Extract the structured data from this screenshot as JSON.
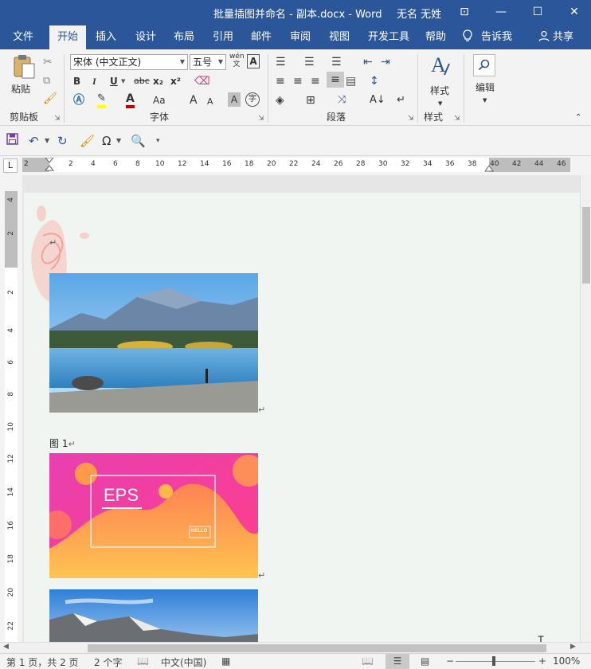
{
  "titlebar": {
    "doc_title": "批量插图并命名 - 副本.docx  -  Word",
    "user": "无名 无姓",
    "minimize": "—",
    "restore": "☐",
    "close": "✕",
    "ribbon_display": "⊡"
  },
  "menu": {
    "tabs": [
      "文件",
      "开始",
      "插入",
      "设计",
      "布局",
      "引用",
      "邮件",
      "审阅",
      "视图",
      "开发工具",
      "帮助"
    ],
    "active": "开始",
    "tell_me": "告诉我",
    "share": "共享"
  },
  "ribbon": {
    "clipboard": {
      "paste": "粘贴",
      "label": "剪贴板"
    },
    "font": {
      "name": "宋体 (中文正文)",
      "size": "五号",
      "label": "字体",
      "bold": "B",
      "italic": "I",
      "underline": "U",
      "strike": "abc",
      "sub": "x₂",
      "sup": "x²",
      "grow": "A",
      "shrink": "A",
      "case": "Aa",
      "wen": "wén",
      "char_border": "A",
      "char_shade": "A",
      "enclose": "字"
    },
    "paragraph": {
      "label": "段落"
    },
    "styles": {
      "button": "样式",
      "label": "样式"
    },
    "editing": {
      "button": "编辑"
    }
  },
  "ruler": {
    "tab_selector": "L",
    "h_ticks": [
      "2",
      "2",
      "4",
      "6",
      "8",
      "10",
      "12",
      "14",
      "16",
      "18",
      "20",
      "22",
      "24",
      "26",
      "28",
      "30",
      "32",
      "34",
      "36",
      "38",
      "40",
      "42",
      "44",
      "46"
    ],
    "v_ticks": [
      "4",
      "2",
      "2",
      "4",
      "6",
      "8",
      "10",
      "12",
      "14",
      "16",
      "18",
      "20",
      "22"
    ]
  },
  "document": {
    "caption": "图 1",
    "eps_title": "EPS",
    "hello_badge": "HELLO"
  },
  "statusbar": {
    "page": "第 1 页，共 2 页",
    "words": "2 个字",
    "language": "中文(中国)",
    "zoom_minus": "−",
    "zoom_plus": "+",
    "zoom": "100%",
    "zoom_level": 1.0
  },
  "colors": {
    "brand": "#2b579a",
    "font_color": "#c00000",
    "highlight": "#ffff00"
  }
}
